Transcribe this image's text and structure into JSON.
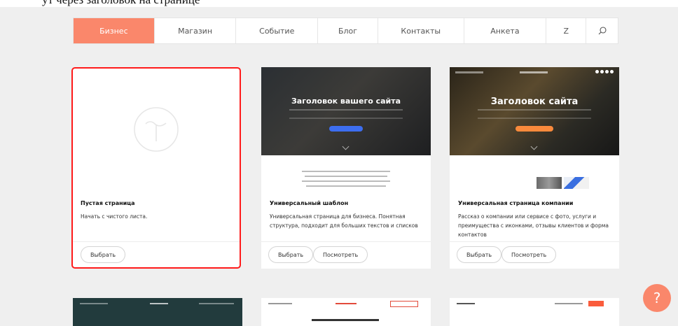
{
  "top_text": "ут через заголовок на странице",
  "tabs": [
    {
      "label": "Бизнес",
      "active": true
    },
    {
      "label": "Магазин",
      "active": false
    },
    {
      "label": "Событие",
      "active": false
    },
    {
      "label": "Блог",
      "active": false
    },
    {
      "label": "Контакты",
      "active": false
    },
    {
      "label": "Анкета",
      "active": false
    },
    {
      "label": "Z",
      "active": false
    }
  ],
  "search_icon": "search-icon",
  "accent_color": "#fa876b",
  "selection_color": "#ff1a1a",
  "cards": [
    {
      "title": "Пустая страница",
      "desc": "Начать с чистого листа.",
      "select_label": "Выбрать",
      "selected": true
    },
    {
      "title": "Универсальный шаблон",
      "desc": "Универсальная страница для бизнеса. Понятная структура, подходит для больших текстов и списков",
      "select_label": "Выбрать",
      "preview_label": "Посмотреть",
      "hero_title": "Заголовок вашего сайта",
      "hero_button_color": "#3d6ef0"
    },
    {
      "title": "Универсальная страница компании",
      "desc": "Рассказ о компании или сервисе с фото, услуги и преимущества с иконками, отзывы клиентов и форма контактов",
      "select_label": "Выбрать",
      "preview_label": "Посмотреть",
      "hero_title": "Заголовок сайта",
      "hero_button_color": "#fa8a3c"
    }
  ],
  "help_label": "?"
}
